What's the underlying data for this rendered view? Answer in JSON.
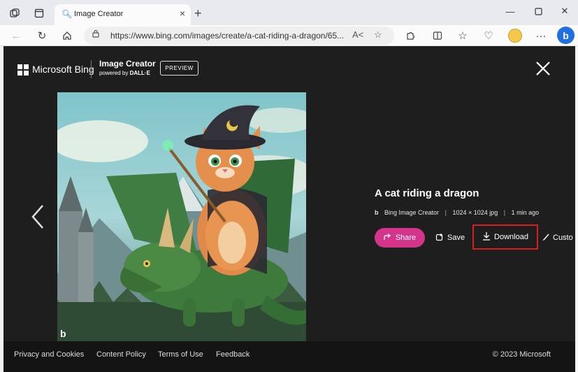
{
  "browser": {
    "tab_title": "Image Creator",
    "url": "https://www.bing.com/images/create/a-cat-riding-a-dragon/65...",
    "icons": [
      "workspaces-icon",
      "tab-actions-icon",
      "search-favicon",
      "close-icon",
      "plus-icon",
      "minimize-icon",
      "maximize-icon",
      "close-icon",
      "back-icon",
      "refresh-icon",
      "home-icon",
      "lock-icon",
      "read-aloud-icon",
      "favorite-star-icon",
      "extensions-icon",
      "split-screen-icon",
      "favorites-icon",
      "browser-essentials-icon",
      "profile-avatar",
      "more-icon",
      "bing-copilot-icon"
    ]
  },
  "modal": {
    "brand": "Microsoft Bing",
    "product_title": "Image Creator",
    "product_subtitle_prefix": "powered by",
    "product_subtitle_brand": "DALL·E",
    "preview_badge": "PREVIEW",
    "image_title": "A cat riding a dragon",
    "meta": {
      "logo": "b",
      "source": "Bing Image Creator",
      "size": "1024 × 1024 jpg",
      "age": "1 min ago"
    },
    "actions": {
      "share": "Share",
      "save": "Save",
      "download": "Download",
      "customize": "Custo"
    },
    "image_watermark": "b"
  },
  "footer": {
    "links": [
      "Privacy and Cookies",
      "Content Policy",
      "Terms of Use",
      "Feedback"
    ],
    "copyright": "© 2023 Microsoft"
  },
  "colors": {
    "share_button": "#d4358b",
    "download_highlight": "#d81e1e",
    "modal_bg": "#1f1e1f",
    "footer_bg": "#141414"
  }
}
